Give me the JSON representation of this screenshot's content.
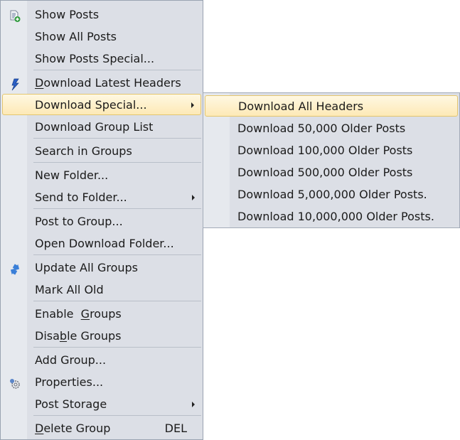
{
  "main_menu": {
    "items": [
      {
        "label": "Show Posts",
        "icon": "document-add-icon"
      },
      {
        "label": "Show All Posts"
      },
      {
        "label": "Show Posts Special..."
      },
      {
        "label": "Download Latest Headers",
        "icon": "lightning-icon",
        "mnemonic": "D"
      },
      {
        "label": "Download Special...",
        "submenu": true,
        "highlighted": true
      },
      {
        "label": "Download Group List"
      },
      {
        "label": "Search in Groups"
      },
      {
        "label": "New Folder..."
      },
      {
        "label": "Send to Folder...",
        "submenu": true
      },
      {
        "label": "Post to Group..."
      },
      {
        "label": "Open Download Folder..."
      },
      {
        "label": "Update All Groups",
        "icon": "refresh-arrows-icon"
      },
      {
        "label": "Mark All Old"
      },
      {
        "label": "Enable  Groups",
        "mnemonic": "G"
      },
      {
        "label": "Disable Groups",
        "mnemonic": "b"
      },
      {
        "label": "Add Group..."
      },
      {
        "label": "Properties...",
        "icon": "gear-icon"
      },
      {
        "label": "Post Storage",
        "submenu": true
      },
      {
        "label": "Delete Group",
        "shortcut": "DEL",
        "mnemonic": "D"
      }
    ]
  },
  "sub_menu": {
    "parent": "Download Special...",
    "items": [
      {
        "label": "Download All Headers",
        "highlighted": true
      },
      {
        "label": "Download 50,000 Older Posts"
      },
      {
        "label": "Download 100,000 Older Posts"
      },
      {
        "label": "Download 500,000 Older Posts"
      },
      {
        "label": "Download 5,000,000 Older Posts."
      },
      {
        "label": "Download 10,000,000 Older Posts."
      }
    ]
  }
}
